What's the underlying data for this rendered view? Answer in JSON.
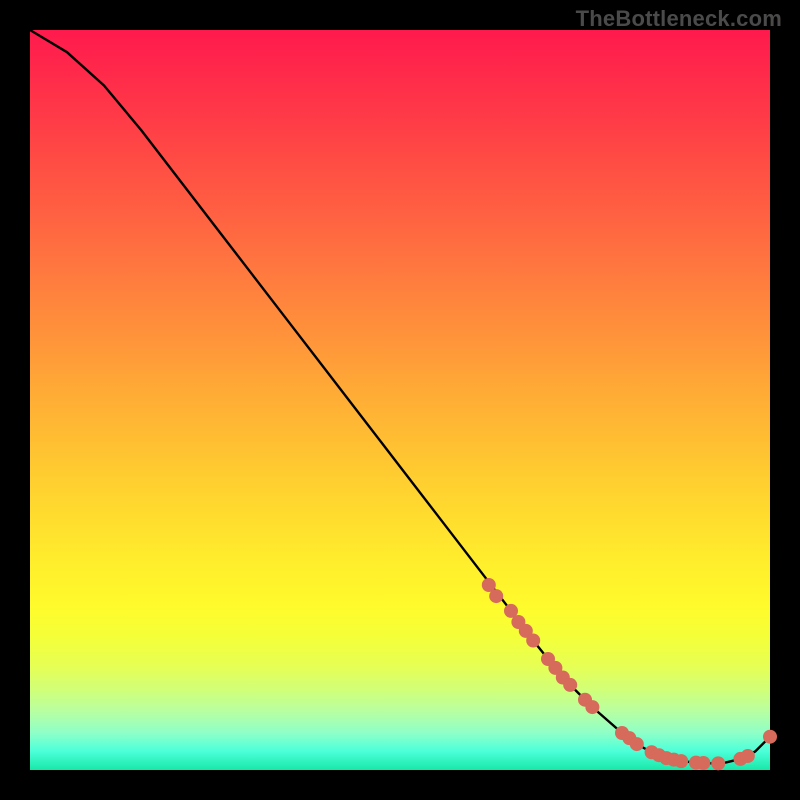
{
  "watermark": "TheBottleneck.com",
  "colors": {
    "background": "#000000",
    "gradient_top": "#ff1a4d",
    "gradient_bottom": "#18e8a8",
    "curve": "#000000",
    "markers": "#d66a5b"
  },
  "chart_data": {
    "type": "line",
    "title": "",
    "xlabel": "",
    "ylabel": "",
    "xlim": [
      0,
      100
    ],
    "ylim": [
      0,
      100
    ],
    "series": [
      {
        "name": "bottleneck-curve",
        "x": [
          0,
          5,
          10,
          15,
          20,
          25,
          30,
          35,
          40,
          45,
          50,
          55,
          60,
          65,
          68,
          72,
          76,
          80,
          82,
          84,
          86,
          88,
          90,
          92,
          94,
          96,
          98,
          100
        ],
        "y": [
          100,
          97,
          92.5,
          86.5,
          80,
          73.5,
          67,
          60.5,
          54,
          47.5,
          41,
          34.5,
          28,
          21.5,
          17.5,
          12.5,
          8.5,
          5,
          3.5,
          2.4,
          1.6,
          1.2,
          1.0,
          0.9,
          1.0,
          1.5,
          2.5,
          4.5
        ]
      }
    ],
    "markers": {
      "name": "highlighted-points",
      "x": [
        62,
        63,
        65,
        66,
        67,
        68,
        70,
        71,
        72,
        73,
        75,
        76,
        80,
        81,
        82,
        84,
        85,
        86,
        87,
        88,
        90,
        91,
        93,
        96,
        97,
        100
      ],
      "y": [
        25,
        23.5,
        21.5,
        20,
        18.8,
        17.5,
        15,
        13.8,
        12.5,
        11.5,
        9.5,
        8.5,
        5,
        4.3,
        3.5,
        2.4,
        2.0,
        1.6,
        1.4,
        1.2,
        1.0,
        0.95,
        0.9,
        1.5,
        1.9,
        4.5
      ]
    }
  }
}
